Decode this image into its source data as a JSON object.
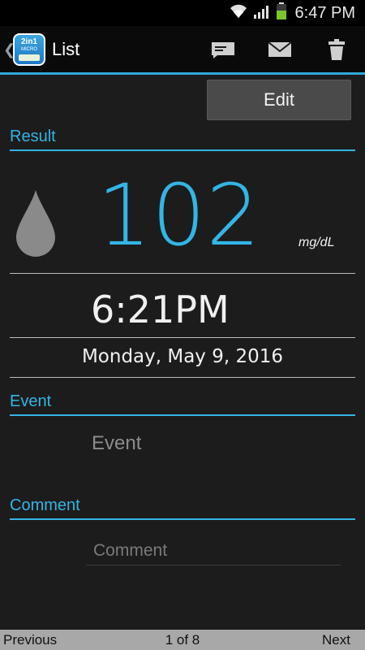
{
  "status_bar": {
    "time": "6:47 PM",
    "icons": [
      "wifi-icon",
      "signal-icon",
      "battery-icon"
    ]
  },
  "action_bar": {
    "title": "List",
    "logo_text_top": "2in1",
    "logo_text_bottom": "MICRO",
    "actions": [
      "message-icon",
      "email-icon",
      "trash-icon"
    ]
  },
  "edit_label": "Edit",
  "result": {
    "header": "Result",
    "value": "102",
    "unit": "mg/dL"
  },
  "time": "6:21PM",
  "date": "Monday, May 9, 2016",
  "event": {
    "header": "Event",
    "value": "Event"
  },
  "comment": {
    "header": "Comment",
    "placeholder": "Comment"
  },
  "pagination": {
    "previous": "Previous",
    "page": "1 of 8",
    "next": "Next"
  },
  "colors": {
    "accent": "#33b5e5",
    "background": "#1c1c1c"
  }
}
